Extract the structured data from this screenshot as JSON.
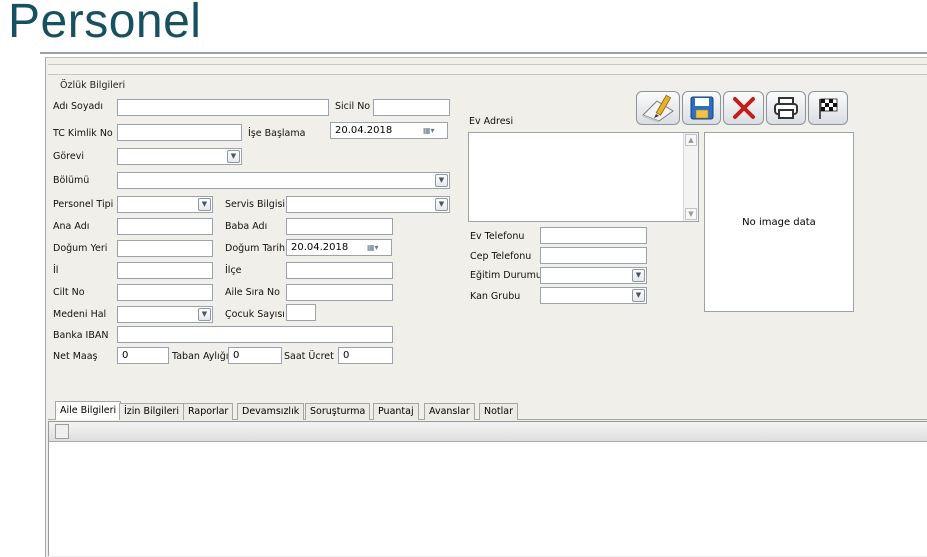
{
  "page": {
    "title": "Personel"
  },
  "section": {
    "label": "Özlük Bilgileri"
  },
  "labels": {
    "adi_soyadi": "Adı Soyadı",
    "sicil_no": "Sicil No",
    "tc_kimlik_no": "TC Kimlik No",
    "ise_baslama": "İşe Başlama",
    "gorevi": "Görevi",
    "bolumu": "Bölümü",
    "personel_tipi": "Personel Tipi",
    "servis_bilgisi": "Servis Bilgisi",
    "ana_adi": "Ana Adı",
    "baba_adi": "Baba Adı",
    "dogum_yeri": "Doğum Yeri",
    "dogum_tarihi": "Doğum Tarihi",
    "il": "İl",
    "ilce": "İlçe",
    "cilt_no": "Cilt No",
    "aile_sira_no": "Aile Sıra No",
    "medeni_hal": "Medeni Hal",
    "cocuk_sayisi": "Çocuk Sayısı",
    "banka_iban": "Banka IBAN",
    "net_maas": "Net Maaş",
    "taban_ayligi": "Taban Aylığı",
    "saat_ucret": "Saat Ücret",
    "ev_adresi": "Ev Adresi",
    "ev_telefonu": "Ev Telefonu",
    "cep_telefonu": "Cep Telefonu",
    "egitim_durumu": "Eğitim Durumu",
    "kan_grubu": "Kan Grubu"
  },
  "values": {
    "ise_baslama": "20.04.2018",
    "dogum_tarihi": "20.04.2018",
    "net_maas": "0",
    "taban_ayligi": "0",
    "saat_ucret": "0"
  },
  "toolbar": {
    "icons": [
      "edit-icon",
      "save-icon",
      "delete-icon",
      "print-icon",
      "finish-flag-icon"
    ]
  },
  "image": {
    "placeholder": "No image data"
  },
  "tabs": [
    {
      "label": "Aile Bilgileri",
      "active": true
    },
    {
      "label": "İzin Bilgileri",
      "active": false
    },
    {
      "label": "Raporlar",
      "active": false
    },
    {
      "label": "Devamsızlık",
      "active": false
    },
    {
      "label": "Soruşturma",
      "active": false
    },
    {
      "label": "Puantaj",
      "active": false
    },
    {
      "label": "Avanslar",
      "active": false
    },
    {
      "label": "Notlar",
      "active": false
    }
  ],
  "colors": {
    "title": "#17505f",
    "delete_red": "#c0201b",
    "save_blue": "#2b6fc4"
  }
}
